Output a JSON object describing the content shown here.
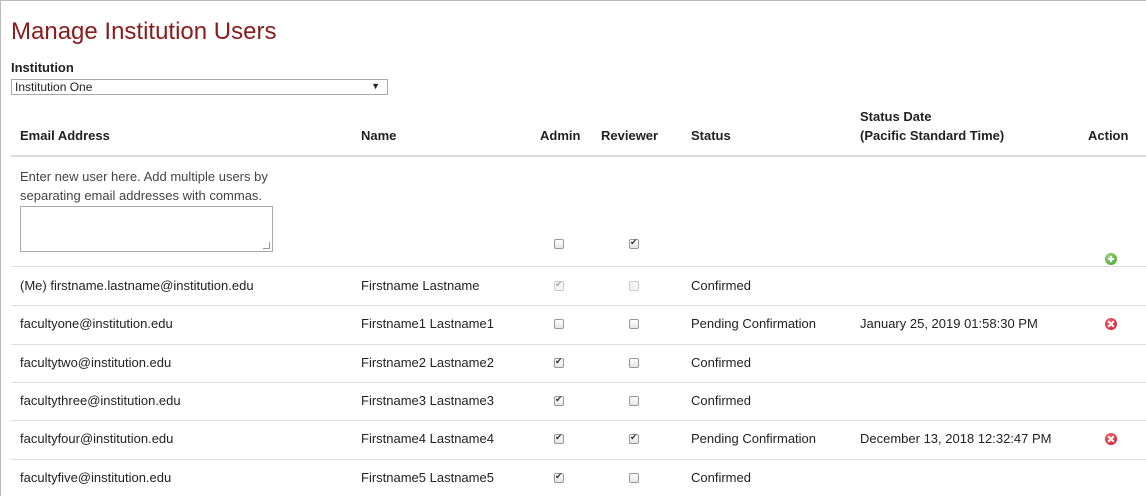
{
  "page": {
    "title": "Manage Institution Users"
  },
  "institution": {
    "label": "Institution",
    "selected": "Institution One"
  },
  "table": {
    "headers": {
      "email": "Email Address",
      "name": "Name",
      "admin": "Admin",
      "reviewer": "Reviewer",
      "status": "Status",
      "status_date_line1": "Status Date",
      "status_date_line2": "(Pacific Standard Time)",
      "action": "Action"
    },
    "new_user": {
      "hint": "Enter new user here. Add multiple users by separating email addresses with commas.",
      "textarea_value": "",
      "admin": false,
      "reviewer": true
    },
    "rows": [
      {
        "email": "(Me) firstname.lastname@institution.edu",
        "name": "Firstname Lastname",
        "admin": true,
        "reviewer": false,
        "status": "Confirmed",
        "status_date": "",
        "disabled": true,
        "deletable": false
      },
      {
        "email": "facultyone@institution.edu",
        "name": "Firstname1 Lastname1",
        "admin": false,
        "reviewer": false,
        "status": "Pending Confirmation",
        "status_date": "January 25, 2019 01:58:30 PM",
        "disabled": false,
        "deletable": true
      },
      {
        "email": "facultytwo@institution.edu",
        "name": "Firstname2 Lastname2",
        "admin": true,
        "reviewer": false,
        "status": "Confirmed",
        "status_date": "",
        "disabled": false,
        "deletable": false
      },
      {
        "email": "facultythree@institution.edu",
        "name": "Firstname3 Lastname3",
        "admin": true,
        "reviewer": false,
        "status": "Confirmed",
        "status_date": "",
        "disabled": false,
        "deletable": false
      },
      {
        "email": "facultyfour@institution.edu",
        "name": "Firstname4 Lastname4",
        "admin": true,
        "reviewer": true,
        "status": "Pending Confirmation",
        "status_date": "December 13, 2018 12:32:47 PM",
        "disabled": false,
        "deletable": true
      },
      {
        "email": "facultyfive@institution.edu",
        "name": "Firstname5 Lastname5",
        "admin": true,
        "reviewer": false,
        "status": "Confirmed",
        "status_date": "",
        "disabled": false,
        "deletable": false
      }
    ]
  },
  "icons": {
    "add": "plus-circle-icon",
    "delete": "x-circle-icon"
  },
  "colors": {
    "title": "#8b1a1a",
    "add_icon": "#3d9a2a",
    "delete_icon": "#c8102e"
  }
}
